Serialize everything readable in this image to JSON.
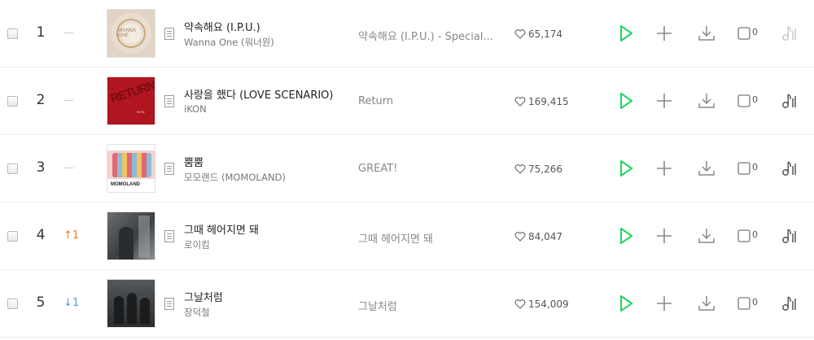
{
  "colors": {
    "accent_green": "#1ed760",
    "rank_up": "#f07a24",
    "rank_down": "#4a9be6"
  },
  "rows": [
    {
      "rank": "1",
      "change": "—",
      "change_type": "none",
      "title": "약속해요 (I.P.U.)",
      "artist": "Wanna One (워너원)",
      "album": "약속해요 (I.P.U.) - Special...",
      "likes": "65,174",
      "video_count": "0",
      "cover_style": "wannaone",
      "cover_text": "WANNA ONE",
      "music_icon_active": false
    },
    {
      "rank": "2",
      "change": "—",
      "change_type": "none",
      "title": "사랑을 했다 (LOVE SCENARIO)",
      "artist": "iKON",
      "album": "Return",
      "likes": "169,415",
      "video_count": "0",
      "cover_style": "ikon",
      "cover_text": "RETURN",
      "music_icon_active": true
    },
    {
      "rank": "3",
      "change": "—",
      "change_type": "none",
      "title": "뿜뿜",
      "artist": "모모랜드 (MOMOLAND)",
      "album": "GREAT!",
      "likes": "75,266",
      "video_count": "0",
      "cover_style": "momoland",
      "cover_text": "MOMOLAND",
      "music_icon_active": true
    },
    {
      "rank": "4",
      "change": "↑1",
      "change_type": "up",
      "title": "그때 헤어지면 돼",
      "artist": "로이킴",
      "album": "그때 헤어지면 돼",
      "likes": "84,047",
      "video_count": "0",
      "cover_style": "roykim",
      "cover_text": "",
      "music_icon_active": true
    },
    {
      "rank": "5",
      "change": "↓1",
      "change_type": "down",
      "title": "그날처럼",
      "artist": "장덕철",
      "album": "그날처럼",
      "likes": "154,009",
      "video_count": "0",
      "cover_style": "jdc",
      "cover_text": "",
      "music_icon_active": true
    }
  ]
}
